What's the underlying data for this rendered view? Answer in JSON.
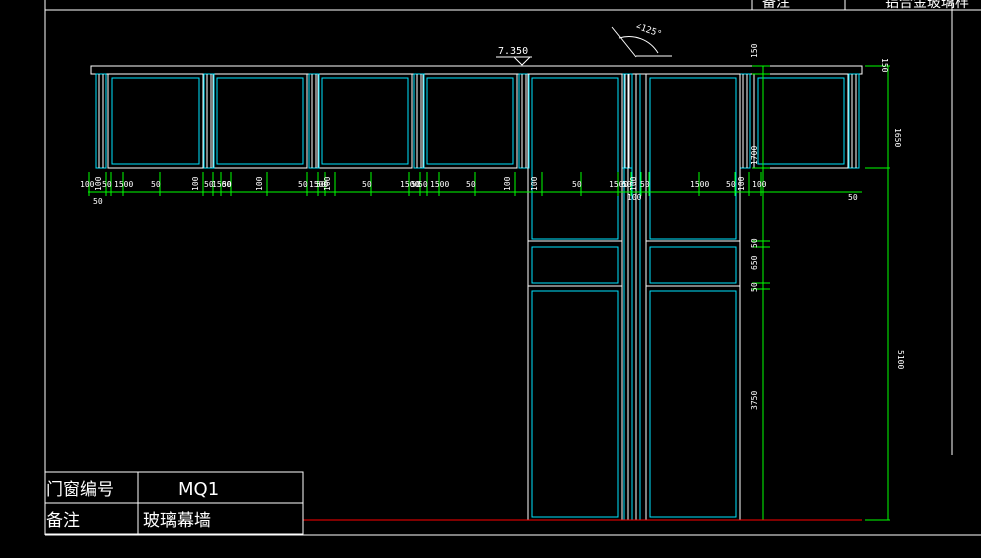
{
  "title_block_top": {
    "note_label": "备注",
    "right_text": "铝合金玻璃样"
  },
  "elevation": {
    "level_mark": "7.350",
    "angle_mark": "∠125°"
  },
  "dimensions": {
    "bottom_row": [
      "100",
      "100",
      "50",
      "1500",
      "50",
      "100",
      "50",
      "1500",
      "50",
      "100",
      "50",
      "1500",
      "50",
      "100",
      "50",
      "1500",
      "50",
      "50",
      "1500",
      "50",
      "100",
      "100",
      "50",
      "1500",
      "50",
      "100",
      "50",
      "1500",
      "50",
      "100",
      "100"
    ],
    "below_row": [
      "50",
      "100",
      "50"
    ],
    "right_vertical": [
      "150",
      "1700",
      "50",
      "650",
      "50",
      "3750"
    ],
    "far_right": [
      "150",
      "1650",
      "5100"
    ]
  },
  "legend_table": {
    "row1_label": "门窗编号",
    "row1_value": "MQ1",
    "row2_label": "备注",
    "row2_value": "玻璃幕墙"
  },
  "colors": {
    "background": "#000000",
    "frame": "#ffffff",
    "window": "#00e5ff",
    "dimension": "#00ff00",
    "accent": "#ff0000"
  }
}
